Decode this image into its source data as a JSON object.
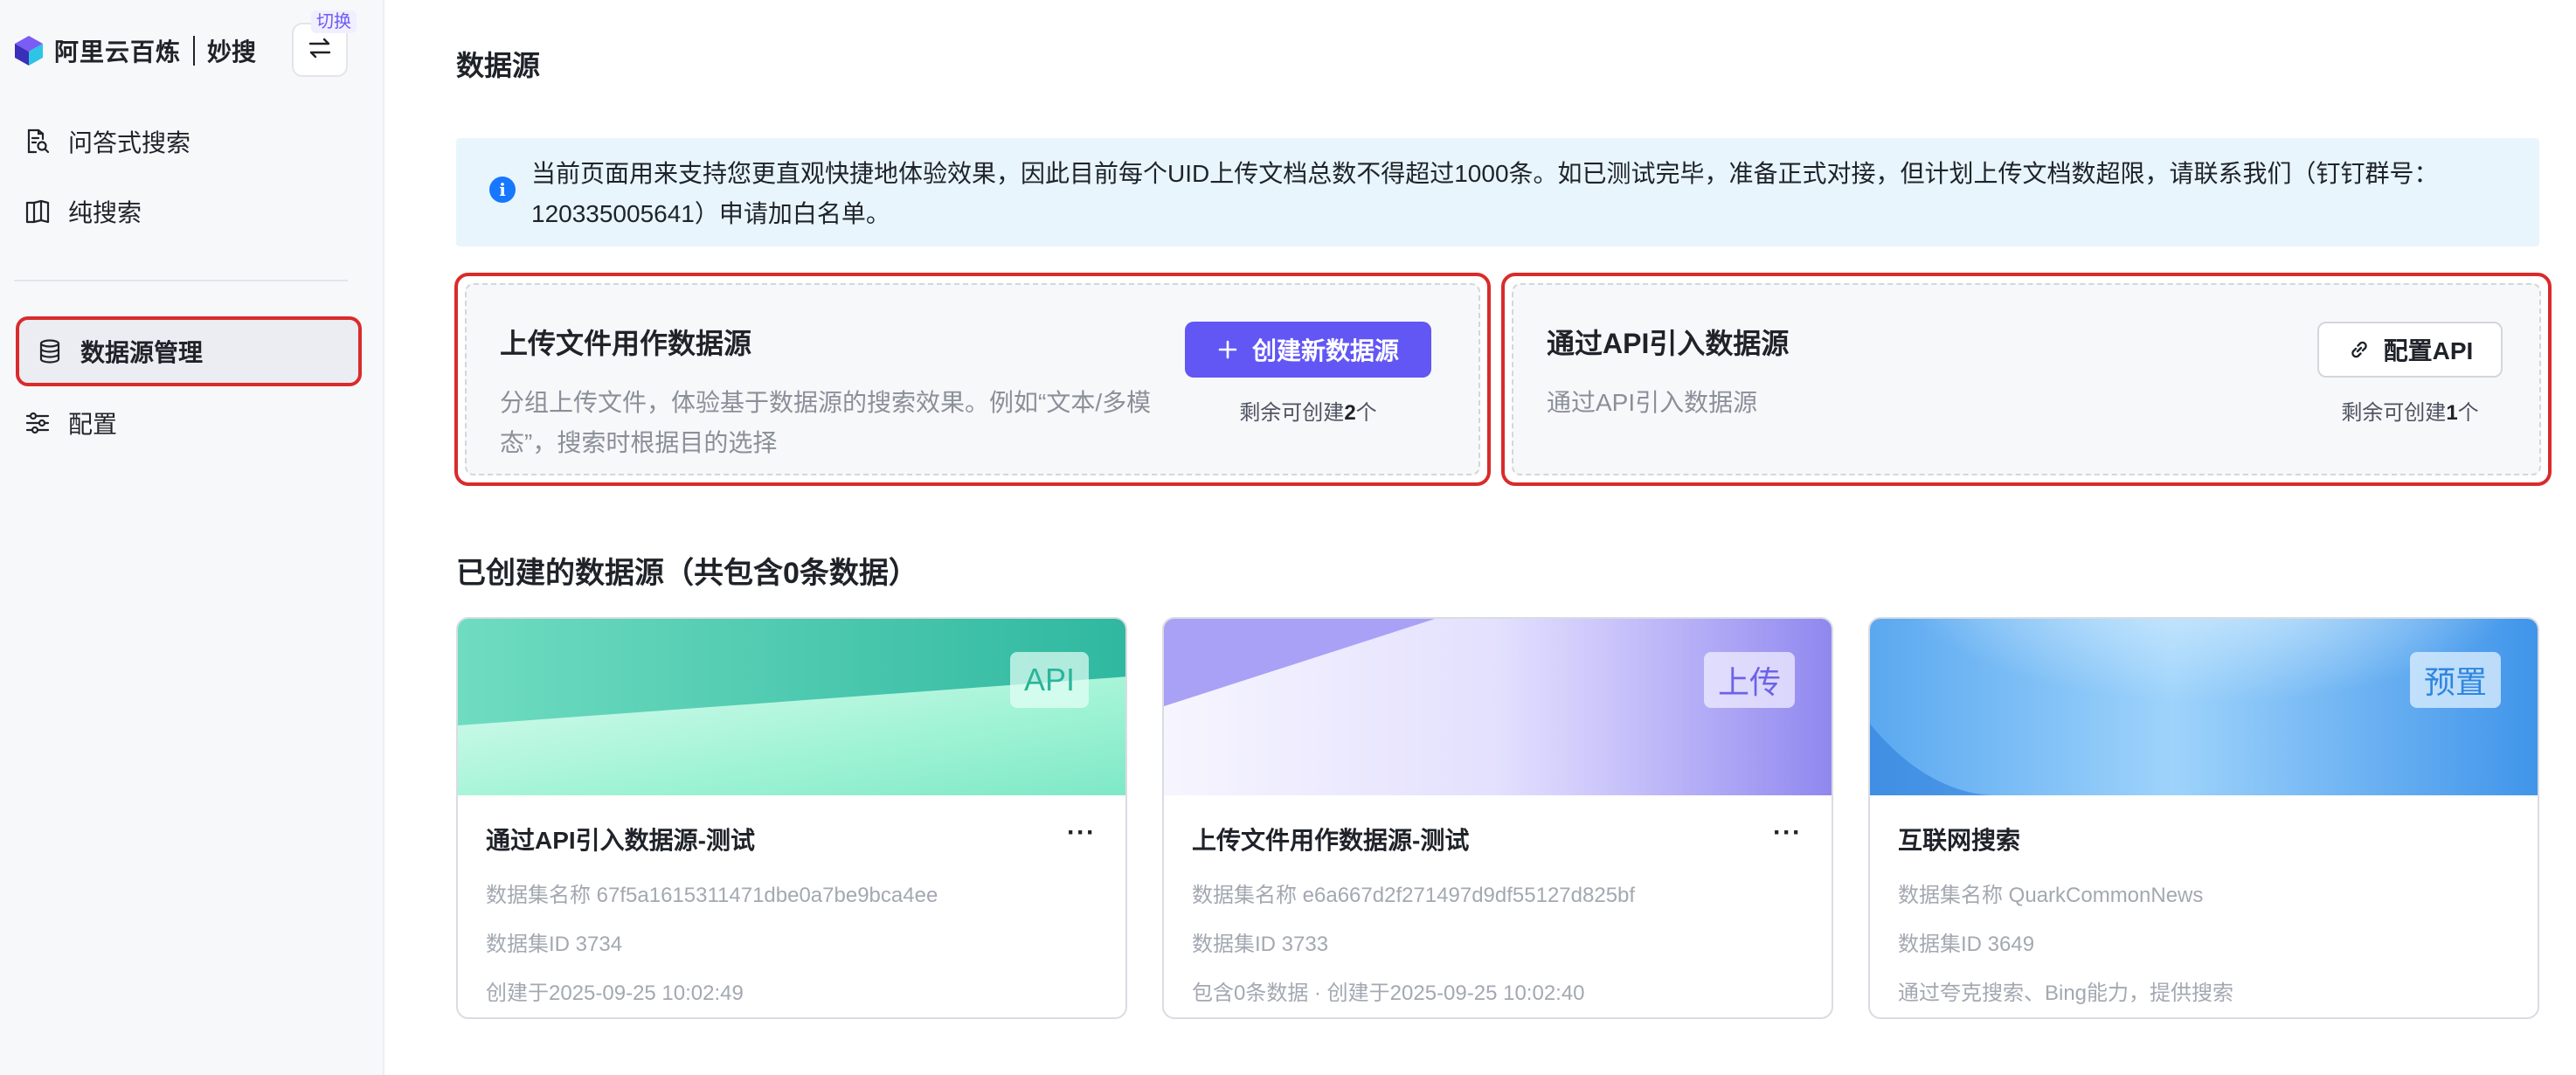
{
  "sidebar": {
    "brand_name": "阿里云百炼",
    "brand_sub": "妙搜",
    "switch_tag": "切换",
    "items": [
      {
        "label": "问答式搜索",
        "icon": "document-search-icon"
      },
      {
        "label": "纯搜索",
        "icon": "book-open-icon"
      },
      {
        "label": "数据源管理",
        "icon": "database-icon",
        "active": true
      },
      {
        "label": "配置",
        "icon": "sliders-icon"
      }
    ]
  },
  "main": {
    "title": "数据源",
    "notice_line1": "当前页面用来支持您更直观快捷地体验效果，因此目前每个UID上传文档总数不得超过1000条。如已测试完毕，准备正式对接，但计划上传文档数超限，请联系我们（钉钉群号：",
    "notice_line2": "120335005641）申请加白名单。",
    "upload_card": {
      "title": "上传文件用作数据源",
      "desc_line1": "分组上传文件，体验基于数据源的搜索效果。例如“文本/多模",
      "desc_line2": "态”，搜索时根据目的选择",
      "button": "创建新数据源",
      "remain_prefix": "剩余可创建",
      "remain_count": "2",
      "remain_suffix": "个"
    },
    "api_card": {
      "title": "通过API引入数据源",
      "desc": "通过API引入数据源",
      "button": "配置API",
      "remain_prefix": "剩余可创建",
      "remain_count": "1",
      "remain_suffix": "个"
    },
    "created_title": "已创建的数据源（共包含0条数据）",
    "datasources": [
      {
        "badge": "API",
        "name": "通过API引入数据源-测试",
        "meta1": "数据集名称 67f5a1615311471dbe0a7be9bca4ee",
        "meta2": "数据集ID 3734",
        "meta3": "创建于2025-09-25 10:02:49",
        "more": "···"
      },
      {
        "badge": "上传",
        "name": "上传文件用作数据源-测试",
        "meta1": "数据集名称 e6a667d2f271497d9df55127d825bf",
        "meta2": "数据集ID 3733",
        "meta3": "包含0条数据 · 创建于2025-09-25 10:02:40",
        "more": "···"
      },
      {
        "badge": "预置",
        "name": "互联网搜索",
        "meta1": "数据集名称 QuarkCommonNews",
        "meta2": "数据集ID 3649",
        "meta3": "通过夸克搜索、Bing能力，提供搜索"
      }
    ],
    "colors": {
      "primary": "#6256f5",
      "highlight_border": "#d92b2b",
      "notice_bg": "#e8f5fd",
      "api_badge": "#2bb59a",
      "upload_badge": "#6b63e8",
      "preset_badge": "#2f86e0"
    }
  }
}
